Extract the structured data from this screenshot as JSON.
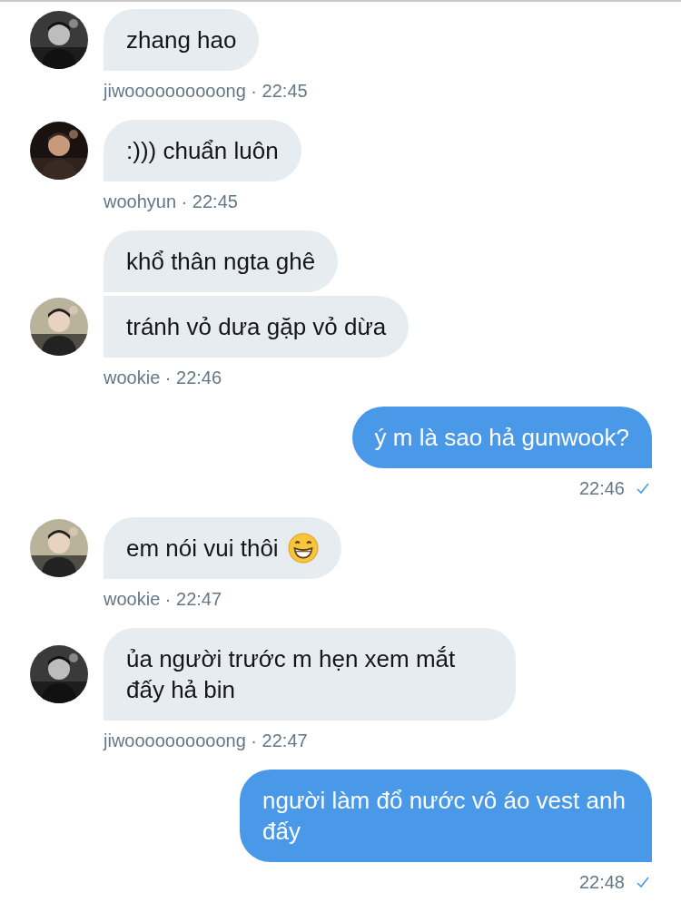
{
  "messages": [
    {
      "kind": "incoming",
      "avatar": {
        "kind": "mono"
      },
      "bubbles": [
        {
          "text": "zhang hao"
        }
      ],
      "meta": "jiwoooooooooong · 22:45"
    },
    {
      "kind": "incoming",
      "avatar": {
        "kind": "dark"
      },
      "bubbles": [
        {
          "text": ":))) chuẩn luôn"
        }
      ],
      "meta": "woohyun · 22:45"
    },
    {
      "kind": "incoming",
      "avatar": {
        "kind": "light"
      },
      "bubbles": [
        {
          "text": "khổ thân ngta ghê"
        },
        {
          "text": "tránh vỏ dưa gặp vỏ dừa"
        }
      ],
      "meta": "wookie · 22:46"
    },
    {
      "kind": "outgoing",
      "read": true,
      "bubbles": [
        {
          "text": "ý m là sao hả gunwook?"
        }
      ],
      "meta": "22:46"
    },
    {
      "kind": "incoming",
      "avatar": {
        "kind": "light"
      },
      "bubbles": [
        {
          "text": "em nói vui thôi",
          "kind": "emoji"
        }
      ],
      "meta": "wookie · 22:47"
    },
    {
      "kind": "incoming",
      "avatar": {
        "kind": "mono"
      },
      "bubbles": [
        {
          "text": "ủa người trước m hẹn xem mắt đấy hả bin"
        }
      ],
      "meta": "jiwoooooooooong · 22:47"
    },
    {
      "kind": "outgoing",
      "read": true,
      "bubbles": [
        {
          "text": "người làm đổ nước vô áo vest anh đấy"
        }
      ],
      "meta": "22:48"
    }
  ]
}
